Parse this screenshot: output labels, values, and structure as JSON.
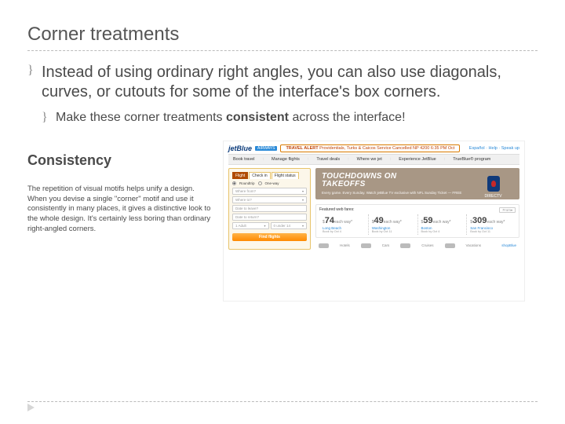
{
  "title": "Corner treatments",
  "bullet_glyph": "}",
  "main_bullet": "Instead of using ordinary right angles, you can also use diagonals, curves, or cutouts for some of the interface's box corners.",
  "sub_bullet_pre": "Make these corner treatments ",
  "sub_bullet_bold": "consistent",
  "sub_bullet_post": " across the interface!",
  "consistency": {
    "heading": "Consistency",
    "paragraph": "The repetition of visual motifs helps unify a design. When you devise a single \"corner\" motif and use it consistently in many places, it gives a distinctive look to the whole design. It's certainly less boring than ordinary right-angled corners."
  },
  "mock": {
    "logo": "jetBlue",
    "logo_badge": "AIRWAYS",
    "alert_label": "TRAVEL ALERT",
    "alert_body": "Providentials, Turks & Caicos Service Cancelled NP 4200 6:35 PM Oct",
    "top_right": "Español · Help · Speak up",
    "tabs": [
      "Book travel",
      "Manage flights",
      "Travel deals",
      "Where we jet",
      "Experience JetBlue",
      "TrueBlue® program"
    ],
    "booking": {
      "tabs": [
        "Flight",
        "Check in",
        "Flight status"
      ],
      "radio_rt": "Roundtrip",
      "radio_ow": "One-way",
      "from": "Where from?",
      "to": "Where to?",
      "leave": "Date to leave?",
      "return": "Date to return?",
      "adult": "1 Adult",
      "kids": "0 under 14",
      "go": "Find flights"
    },
    "hero": {
      "line1": "TOUCHDOWNS ON",
      "line2": "TAKEOFFS",
      "sub": "Every game. Every Sunday. Watch jetBlue TV exclusive with NFL Sunday Ticket — FREE",
      "directv": "DIRECTV"
    },
    "fares": {
      "label": "Featured web fares:",
      "from_opt": "From",
      "items": [
        {
          "price": "74",
          "suffix": "each way*",
          "dest": "Long Beach",
          "note": "Book by Oct 4"
        },
        {
          "price": "49",
          "suffix": "each way*",
          "dest": "Washington",
          "note": "Book by Oct 11"
        },
        {
          "price": "59",
          "suffix": "each way*",
          "dest": "Boston",
          "note": "Book by Oct 4"
        },
        {
          "price": "309",
          "suffix": "each way*",
          "dest": "San Francisco",
          "note": "Book by Oct 11"
        }
      ]
    },
    "foot": [
      "Hotels",
      "Cars",
      "Cruises",
      "Vacations",
      "shopBlue"
    ]
  }
}
